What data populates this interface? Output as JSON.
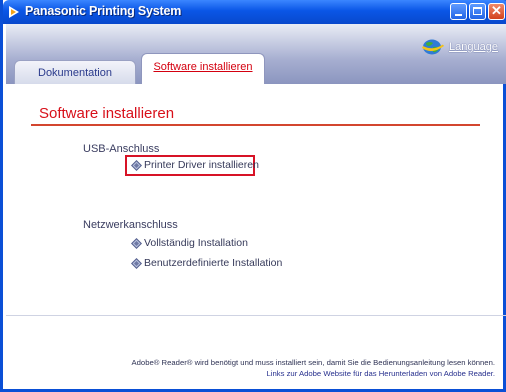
{
  "window": {
    "title": "Panasonic Printing System",
    "title_bar_color": "#0a56e6",
    "accent_red": "#d8101a"
  },
  "header": {
    "language_label": "Language",
    "language_icon": "globe-icon"
  },
  "tabs": [
    {
      "label": "Dokumentation",
      "active": false
    },
    {
      "label": "Software installieren",
      "active": true
    }
  ],
  "main": {
    "page_title": "Software installieren",
    "usb_section_label": "USB-Anschluss",
    "printer_driver_link": "Printer Driver installieren",
    "network_section_label": "Netzwerkanschluss",
    "full_install_link": "Vollständig Installation",
    "custom_install_link": "Benutzerdefinierte Installation",
    "link_icon": "diamond-bullet-icon"
  },
  "footer": {
    "adobe_note": "Adobe® Reader® wird benötigt und muss installiert sein, damit Sie die Bedienungsanleitung lesen können.",
    "adobe_link": "Links zur Adobe Website für das Herunterladen von Adobe Reader."
  }
}
